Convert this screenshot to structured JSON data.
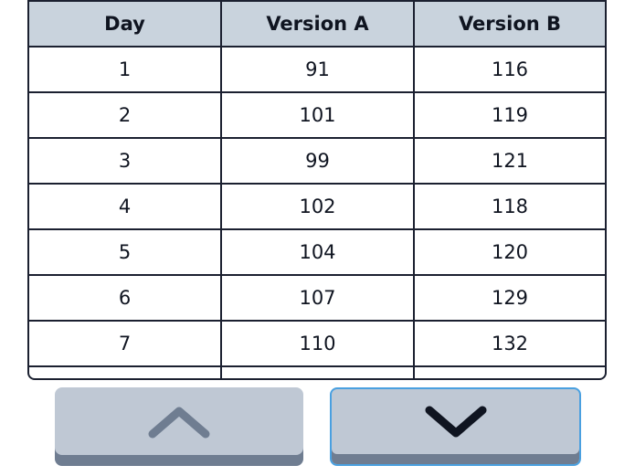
{
  "table": {
    "columns": [
      "Day",
      "Version A",
      "Version B"
    ],
    "rows": [
      [
        "1",
        "91",
        "116"
      ],
      [
        "2",
        "101",
        "119"
      ],
      [
        "3",
        "99",
        "121"
      ],
      [
        "4",
        "102",
        "118"
      ],
      [
        "5",
        "104",
        "120"
      ],
      [
        "6",
        "107",
        "129"
      ],
      [
        "7",
        "110",
        "132"
      ],
      [
        "",
        "",
        ""
      ]
    ]
  },
  "controls": {
    "up_icon": "chevron-up-icon",
    "down_icon": "chevron-down-icon",
    "up_color": "#6f7d91",
    "down_color": "#0f1420",
    "focus_color": "#4aa0e0"
  }
}
